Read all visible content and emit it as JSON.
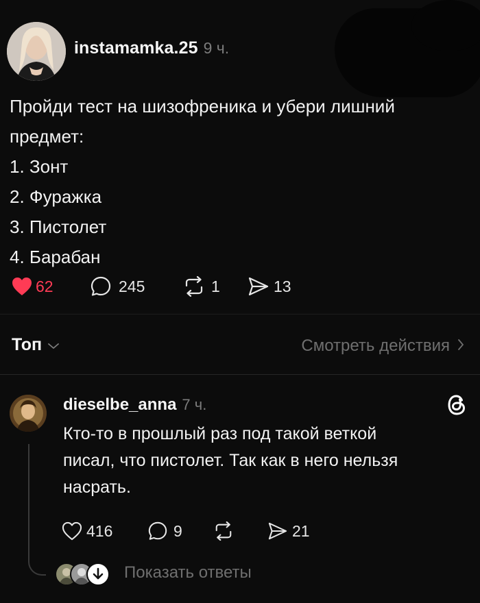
{
  "post": {
    "username": "instamamka.25",
    "time": "9 ч.",
    "lines": [
      "Пройди тест на шизофреника и убери лишний",
      "предмет:",
      "1. Зонт",
      "2. Фуражка",
      "3. Пистолет",
      "4. Барабан"
    ],
    "likes": "62",
    "comments": "245",
    "reposts": "1",
    "shares": "13",
    "liked": true
  },
  "sort": {
    "label": "Топ",
    "view_activity": "Смотреть действия"
  },
  "comment": {
    "username": "dieselbe_anna",
    "time": "7 ч.",
    "lines": [
      "Кто-то в прошлый раз под такой веткой",
      "писал, что пистолет. Так как в него нельзя",
      "насрать."
    ],
    "likes": "416",
    "comments": "9",
    "shares": "21"
  },
  "replies": {
    "label": "Показать ответы"
  },
  "colors": {
    "background": "#0c0c0c",
    "like_active": "#ff3b55",
    "muted": "#7b7b7b"
  },
  "icons": [
    "heart-icon",
    "comment-icon",
    "repost-icon",
    "share-icon",
    "chevron-down-icon",
    "chevron-right-icon",
    "threads-icon",
    "arrow-down-icon"
  ]
}
